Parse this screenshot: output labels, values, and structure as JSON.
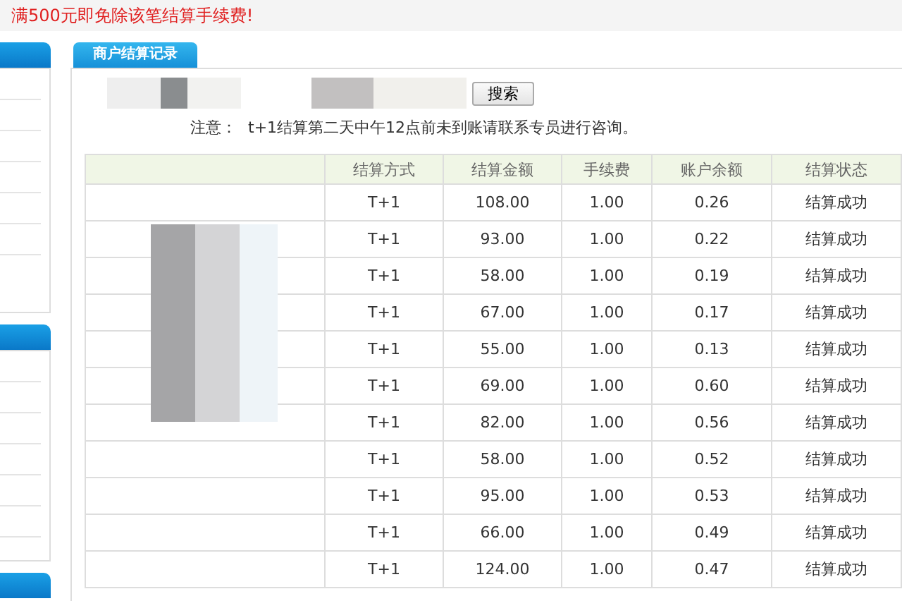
{
  "banner": {
    "text": "满500元即免除该笔结算手续费!"
  },
  "tab": {
    "label": "商户结算记录",
    "selected": true
  },
  "search": {
    "button": "搜索"
  },
  "notice": {
    "label": "注意：",
    "text": "t+1结算第二天中午12点前未到账请联系专员进行咨询。"
  },
  "table": {
    "columns": [
      "结算方式",
      "结算金额",
      "手续费",
      "账户余额",
      "结算状态"
    ],
    "rows": [
      [
        "T+1",
        "108.00",
        "1.00",
        "0.26",
        "结算成功"
      ],
      [
        "T+1",
        "93.00",
        "1.00",
        "0.22",
        "结算成功"
      ],
      [
        "T+1",
        "58.00",
        "1.00",
        "0.19",
        "结算成功"
      ],
      [
        "T+1",
        "67.00",
        "1.00",
        "0.17",
        "结算成功"
      ],
      [
        "T+1",
        "55.00",
        "1.00",
        "0.13",
        "结算成功"
      ],
      [
        "T+1",
        "69.00",
        "1.00",
        "0.60",
        "结算成功"
      ],
      [
        "T+1",
        "82.00",
        "1.00",
        "0.56",
        "结算成功"
      ],
      [
        "T+1",
        "58.00",
        "1.00",
        "0.52",
        "结算成功"
      ],
      [
        "T+1",
        "95.00",
        "1.00",
        "0.53",
        "结算成功"
      ],
      [
        "T+1",
        "66.00",
        "1.00",
        "0.49",
        "结算成功"
      ],
      [
        "T+1",
        "124.00",
        "1.00",
        "0.47",
        "结算成功"
      ]
    ]
  }
}
